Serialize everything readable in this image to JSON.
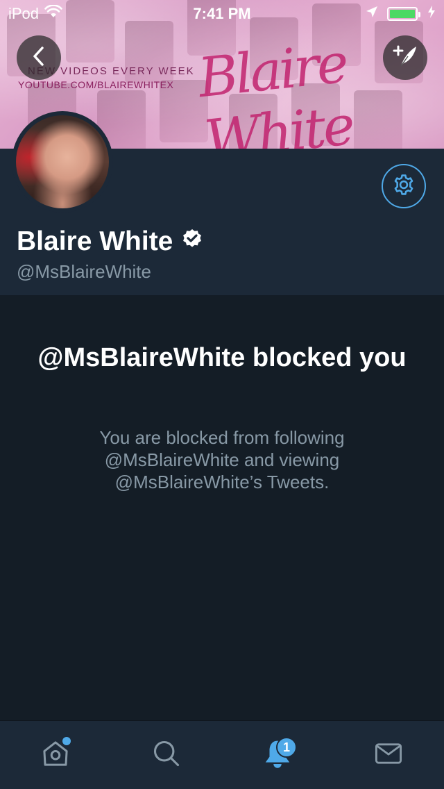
{
  "status_bar": {
    "carrier": "iPod",
    "time": "7:41 PM",
    "battery_level": 1.0,
    "battery_color": "#4cd964"
  },
  "banner": {
    "promo_line1": "NEW VIDEOS EVERY WEEK",
    "promo_line2": "YOUTUBE.COM/BLAIREWHITEX",
    "signature": "Blaire White"
  },
  "profile": {
    "display_name": "Blaire White",
    "handle": "@MsBlaireWhite",
    "verified": true
  },
  "blocked": {
    "title": "@MsBlaireWhite blocked you",
    "description": "You are blocked from following @MsBlaireWhite and viewing @MsBlaireWhite’s Tweets."
  },
  "tab_bar": {
    "items": [
      {
        "name": "home",
        "icon": "home-icon",
        "has_dot": true
      },
      {
        "name": "search",
        "icon": "search-icon"
      },
      {
        "name": "notifications",
        "icon": "bell-icon",
        "badge": "1",
        "active": true
      },
      {
        "name": "messages",
        "icon": "mail-icon"
      }
    ]
  },
  "colors": {
    "accent": "#4fa9e8",
    "background": "#141d26",
    "header_bg": "#1c2938",
    "muted_text": "#8899a6"
  }
}
